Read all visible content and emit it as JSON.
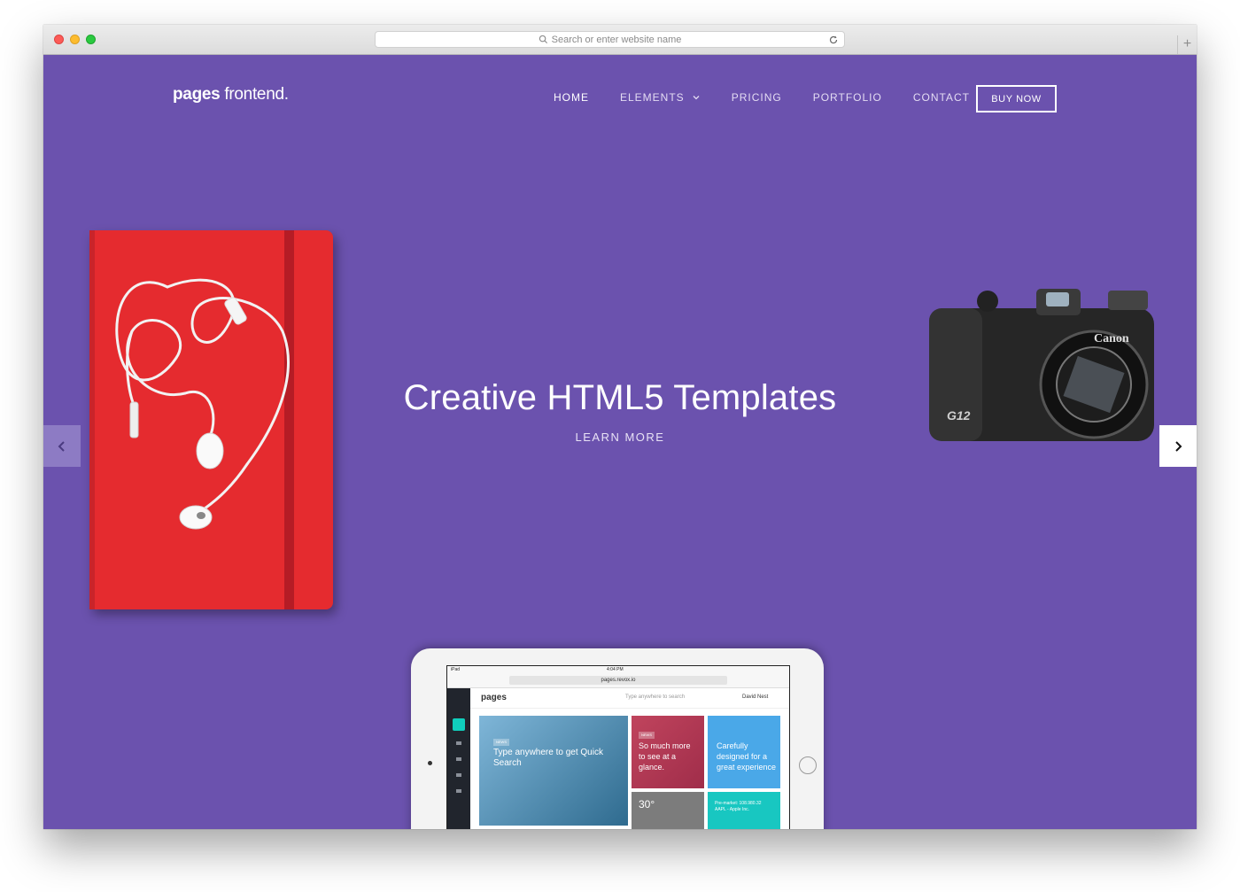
{
  "browser": {
    "search_placeholder": "Search or enter website name",
    "new_tab_label": "+"
  },
  "header": {
    "logo_bold": "pages",
    "logo_light": "frontend.",
    "nav": [
      {
        "label": "HOME"
      },
      {
        "label": "ELEMENTS"
      },
      {
        "label": "PRICING"
      },
      {
        "label": "PORTFOLIO"
      },
      {
        "label": "CONTACT"
      }
    ],
    "buy_label": "BUY NOW"
  },
  "hero": {
    "title": "Creative HTML5 Templates",
    "link": "LEARN MORE"
  },
  "camera": {
    "brand": "Canon",
    "model": "G12"
  },
  "tablet": {
    "status_left": "iPad",
    "status_time": "4:04 PM",
    "url": "pages.revox.io",
    "app_logo": "pages",
    "search_placeholder": "Type anywhere to search",
    "user_name": "David Nest",
    "tiles": {
      "t1_tag": "NEWS",
      "t1_text": "Type anywhere to get Quick Search",
      "t2_tag": "NEWS",
      "t2_text": "So much more to see at a glance.",
      "t3_text": "Carefully designed for a great experience",
      "t4_text": "30°",
      "t5_text": "Pre-market: 108.980.32 AAPL - Apple Inc."
    }
  },
  "colors": {
    "hero_bg": "#6b52ae",
    "notebook": "#e52b2f",
    "accent_teal": "#10cfbd"
  }
}
